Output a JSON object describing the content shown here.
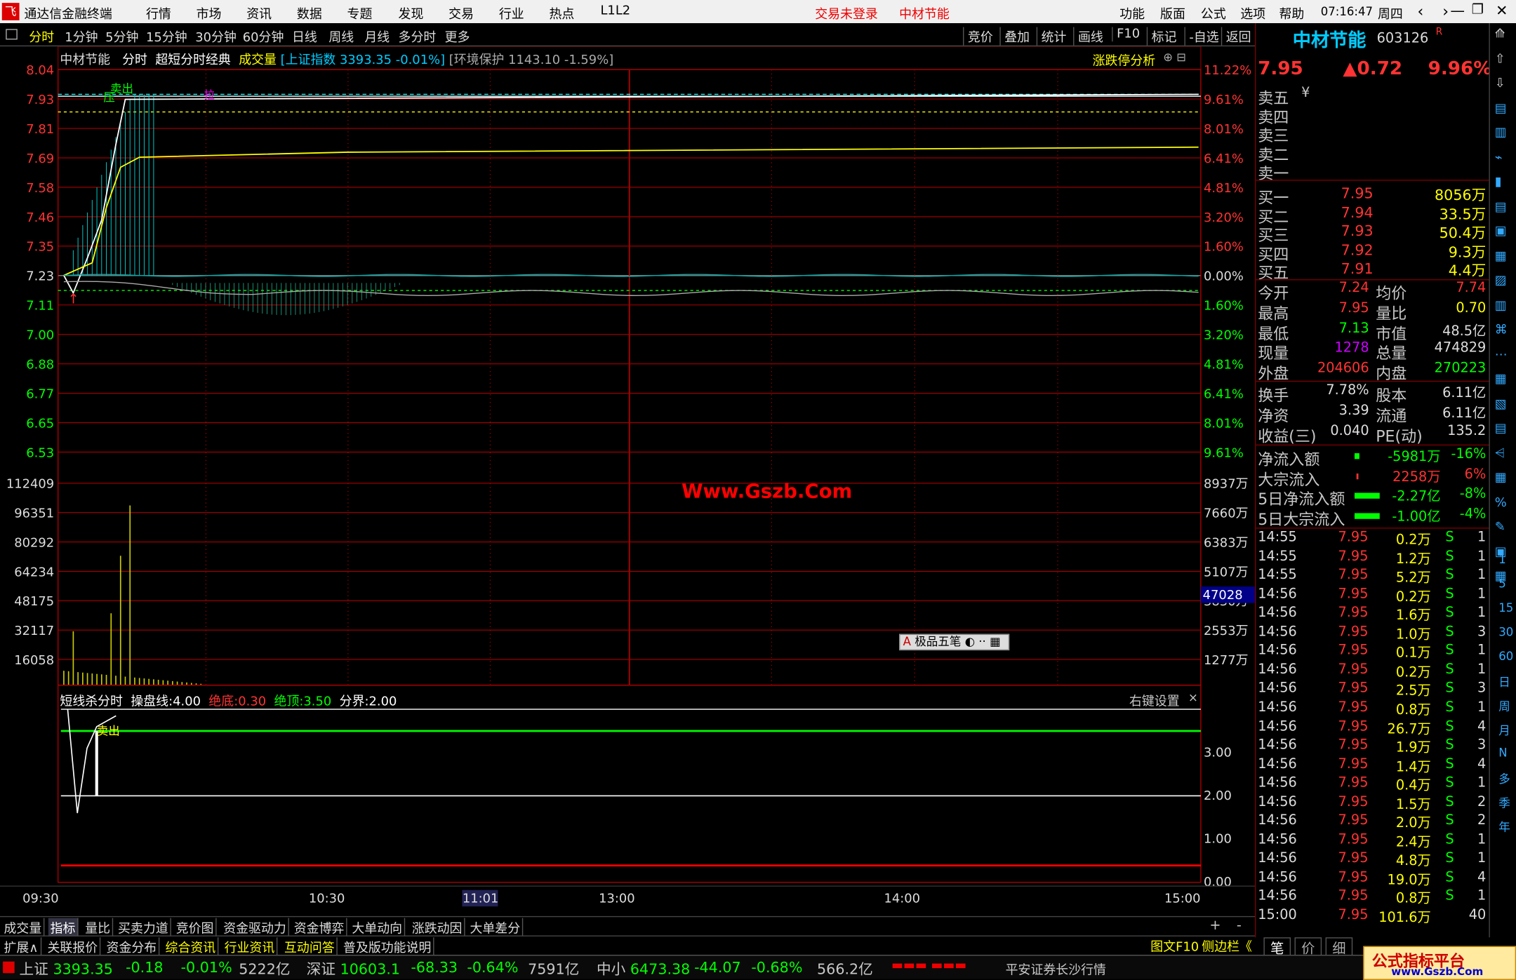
{
  "app": {
    "title": "通达信金融终端",
    "status_alert": "交易未登录",
    "status_stock": "中材节能",
    "time": "07:16:47",
    "weekday": "周四"
  },
  "menu": [
    "行情",
    "市场",
    "资讯",
    "数据",
    "专题",
    "发现",
    "交易",
    "行业",
    "热点",
    "L1L2"
  ],
  "menu_right": [
    "功能",
    "版面",
    "公式",
    "选项",
    "帮助"
  ],
  "timeframes": [
    "分时",
    "1分钟",
    "5分钟",
    "15分钟",
    "30分钟",
    "60分钟",
    "日线",
    "周线",
    "月线",
    "多分时",
    "更多"
  ],
  "toolbar_right": [
    "竞价",
    "叠加",
    "统计",
    "画线",
    "F10",
    "标记",
    "-自选",
    "返回"
  ],
  "chart": {
    "title_stock": "中材节能",
    "title_mode": "分时",
    "title_formula": "超短分时经典",
    "title_vol": "成交量",
    "title_index": "[上证指数",
    "title_index_val": "3393.35 -0.01%]",
    "title_env": "[环境保护 1143.10 -1.59%]",
    "analysis": "涨跌停分析",
    "price_labels": [
      "8.04",
      "7.93",
      "7.81",
      "7.69",
      "7.58",
      "7.46",
      "7.35",
      "7.23",
      "7.11",
      "7.00",
      "6.88",
      "6.77",
      "6.65",
      "6.53"
    ],
    "pct_labels": [
      "11.22%",
      "9.61%",
      "8.01%",
      "6.41%",
      "4.81%",
      "3.20%",
      "1.60%",
      "0.00%",
      "1.60%",
      "3.20%",
      "4.81%",
      "6.41%",
      "8.01%",
      "9.61%"
    ],
    "vol_labels": [
      "112409",
      "96351",
      "80292",
      "64234",
      "48175",
      "32117",
      "16058"
    ],
    "vol_amt": [
      "8937万",
      "7660万",
      "6383万",
      "5107万",
      "3830万",
      "2553万",
      "1277万"
    ],
    "vol_current": "47028",
    "watermark": "Www.Gszb.Com",
    "ime": "极品五笔",
    "sell": "卖出",
    "press": "压",
    "tick_mark": "拉",
    "indicator_title": "短线杀分时",
    "ind_c": "操盘线:",
    "ind_cv": "4.00",
    "ind_bottom": "绝底:",
    "ind_bottomv": "0.30",
    "ind_top": "绝顶:",
    "ind_topv": "3.50",
    "ind_div": "分界:",
    "ind_divv": "2.00",
    "right_click": "右键设置",
    "ind_labels": [
      "3.00",
      "2.00",
      "1.00",
      "0.00"
    ],
    "times": [
      "09:30",
      "10:30",
      "11:01",
      "13:00",
      "14:00",
      "15:00"
    ]
  },
  "chart_data": {
    "type": "line",
    "x": [
      "09:30",
      "10:30",
      "11:30/13:00",
      "14:00",
      "15:00"
    ],
    "prev_close": 7.23,
    "limit_up": 7.95,
    "price_points": [
      [
        0,
        7.23
      ],
      [
        3,
        7.16
      ],
      [
        8,
        7.4
      ],
      [
        15,
        7.95
      ],
      [
        240,
        7.95
      ]
    ],
    "avg_points": [
      [
        0,
        7.23
      ],
      [
        8,
        7.3
      ],
      [
        14,
        7.62
      ],
      [
        20,
        7.7
      ],
      [
        240,
        7.74
      ]
    ],
    "index_points": [
      [
        0,
        7.22
      ],
      [
        20,
        7.18
      ],
      [
        50,
        7.1
      ],
      [
        120,
        7.11
      ],
      [
        240,
        7.12
      ]
    ],
    "volume_peaks": [
      [
        2,
        30000
      ],
      [
        10,
        40000
      ],
      [
        12,
        72000
      ],
      [
        14,
        100000
      ]
    ],
    "indicator": {
      "c_line": 4.0,
      "bottom": 0.3,
      "top": 3.5,
      "divider": 2.0
    }
  },
  "quote": {
    "name": "中材节能",
    "code": "603126",
    "badge": "R",
    "price": "7.95",
    "change": "▲0.72",
    "pct": "9.96%",
    "sell_labels": [
      "卖五",
      "卖四",
      "卖三",
      "卖二",
      "卖一"
    ],
    "sell_unit": "¥",
    "buy": [
      [
        "买一",
        "7.95",
        "8056万"
      ],
      [
        "买二",
        "7.94",
        "33.5万"
      ],
      [
        "买三",
        "7.93",
        "50.4万"
      ],
      [
        "买四",
        "7.92",
        "9.3万"
      ],
      [
        "买五",
        "7.91",
        "4.4万"
      ]
    ],
    "stats": [
      [
        "今开",
        "7.24",
        "均价",
        "7.74"
      ],
      [
        "最高",
        "7.95",
        "量比",
        "0.70"
      ],
      [
        "最低",
        "7.13",
        "市值",
        "48.5亿"
      ],
      [
        "现量",
        "1278",
        "总量",
        "474829"
      ],
      [
        "外盘",
        "204606",
        "内盘",
        "270223"
      ],
      [
        "换手",
        "7.78%",
        "股本",
        "6.11亿"
      ],
      [
        "净资",
        "3.39",
        "流通",
        "6.11亿"
      ],
      [
        "收益(三)",
        "0.040",
        "PE(动)",
        "135.2"
      ]
    ],
    "flows": [
      [
        "净流入额",
        "-5981万",
        "-16%"
      ],
      [
        "大宗流入",
        "2258万",
        "6%"
      ],
      [
        "5日净流入额",
        "-2.27亿",
        "-8%"
      ],
      [
        "5日大宗流入",
        "-1.00亿",
        "-4%"
      ]
    ],
    "ticks": [
      [
        "14:55",
        "7.95",
        "0.2万",
        "S",
        "1"
      ],
      [
        "14:55",
        "7.95",
        "1.2万",
        "S",
        "1"
      ],
      [
        "14:55",
        "7.95",
        "5.2万",
        "S",
        "1"
      ],
      [
        "14:56",
        "7.95",
        "0.2万",
        "S",
        "1"
      ],
      [
        "14:56",
        "7.95",
        "1.6万",
        "S",
        "1"
      ],
      [
        "14:56",
        "7.95",
        "1.0万",
        "S",
        "3"
      ],
      [
        "14:56",
        "7.95",
        "0.1万",
        "S",
        "1"
      ],
      [
        "14:56",
        "7.95",
        "0.2万",
        "S",
        "1"
      ],
      [
        "14:56",
        "7.95",
        "2.5万",
        "S",
        "3"
      ],
      [
        "14:56",
        "7.95",
        "0.8万",
        "S",
        "1"
      ],
      [
        "14:56",
        "7.95",
        "26.7万",
        "S",
        "4"
      ],
      [
        "14:56",
        "7.95",
        "1.9万",
        "S",
        "3"
      ],
      [
        "14:56",
        "7.95",
        "1.4万",
        "S",
        "4"
      ],
      [
        "14:56",
        "7.95",
        "0.4万",
        "S",
        "1"
      ],
      [
        "14:56",
        "7.95",
        "1.5万",
        "S",
        "2"
      ],
      [
        "14:56",
        "7.95",
        "2.0万",
        "S",
        "2"
      ],
      [
        "14:56",
        "7.95",
        "2.4万",
        "S",
        "1"
      ],
      [
        "14:56",
        "7.95",
        "4.8万",
        "S",
        "1"
      ],
      [
        "14:56",
        "7.95",
        "19.0万",
        "S",
        "4"
      ],
      [
        "14:56",
        "7.95",
        "0.8万",
        "S",
        "1"
      ],
      [
        "15:00",
        "7.95",
        "101.6万",
        "",
        "40"
      ]
    ],
    "tabs": [
      "笔",
      "价",
      "细"
    ]
  },
  "vtools": [
    "1",
    "5",
    "15",
    "30",
    "60",
    "日",
    "周",
    "月",
    "N",
    "多",
    "季",
    "年"
  ],
  "bottom_tabs": [
    "成交量",
    "指标",
    "量比",
    "买卖力道",
    "竞价图",
    "资金驱动力",
    "资金博弈",
    "大单动向",
    "涨跌动因",
    "大单差分"
  ],
  "bottom_tabs2": [
    "扩展∧",
    "关联报价",
    "资金分布",
    "综合资讯",
    "行业资讯",
    "互动问答",
    "普及版功能说明"
  ],
  "bottom_right": "图文F10",
  "sidebar_toggle": "侧边栏《",
  "status": {
    "sh": "上证",
    "sh_v": "3393.35",
    "sh_c": "-0.18",
    "sh_p": "-0.01%",
    "sh_a": "5222亿",
    "sz": "深证",
    "sz_v": "10603.1",
    "sz_c": "-68.33",
    "sz_p": "-0.64%",
    "sz_a": "7591亿",
    "zx": "中小",
    "zx_v": "6473.38",
    "zx_c": "-44.07",
    "zx_p": "-0.68%",
    "zx_a": "566.2亿",
    "broker": "平安证券长沙行情",
    "logo": "公式指标平台",
    "logo_url": "www.Gszb.Com"
  }
}
